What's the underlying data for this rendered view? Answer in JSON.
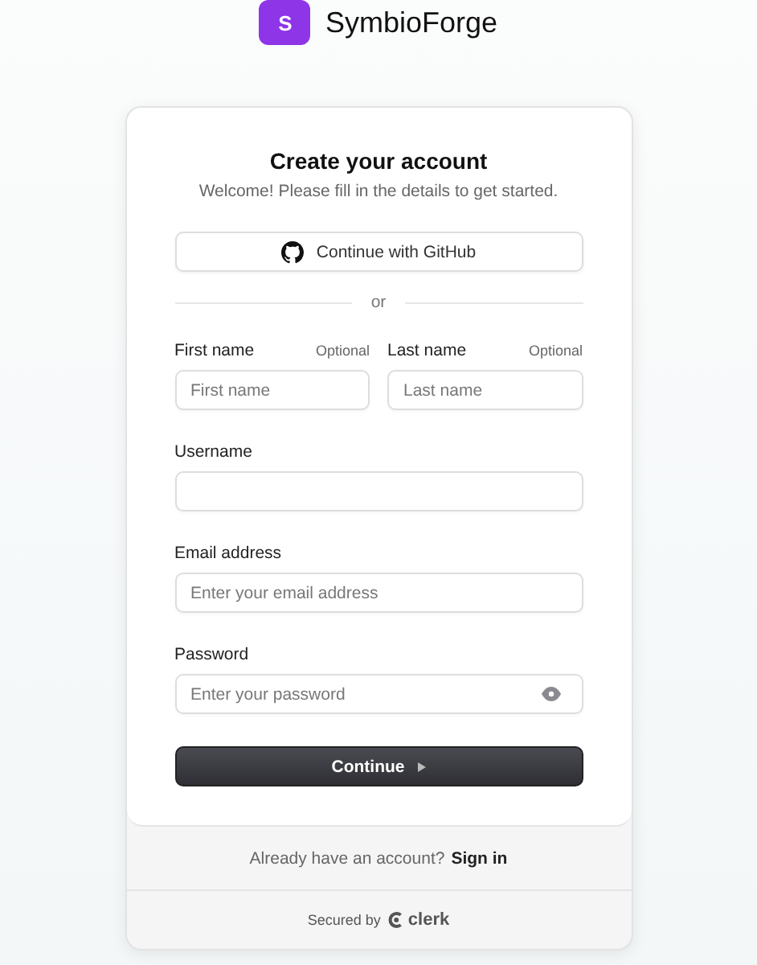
{
  "brand": {
    "initial": "S",
    "name": "SymbioForge"
  },
  "card": {
    "title": "Create your account",
    "subtitle": "Welcome! Please fill in the details to get started.",
    "social_button": "Continue with GitHub",
    "divider": "or",
    "name_fields": [
      {
        "label": "First name",
        "hint": "Optional",
        "placeholder": "First name"
      },
      {
        "label": "Last name",
        "hint": "Optional",
        "placeholder": "Last name"
      }
    ],
    "fields": [
      {
        "label": "Username",
        "kind": "text"
      },
      {
        "label": "Email address",
        "placeholder": "Enter your email address",
        "kind": "text"
      },
      {
        "label": "Password",
        "placeholder": "Enter your password",
        "kind": "password"
      }
    ],
    "submit": "Continue"
  },
  "footer": {
    "prompt": "Already have an account?",
    "link": "Sign in",
    "secured": "Secured by",
    "provider": "clerk"
  }
}
